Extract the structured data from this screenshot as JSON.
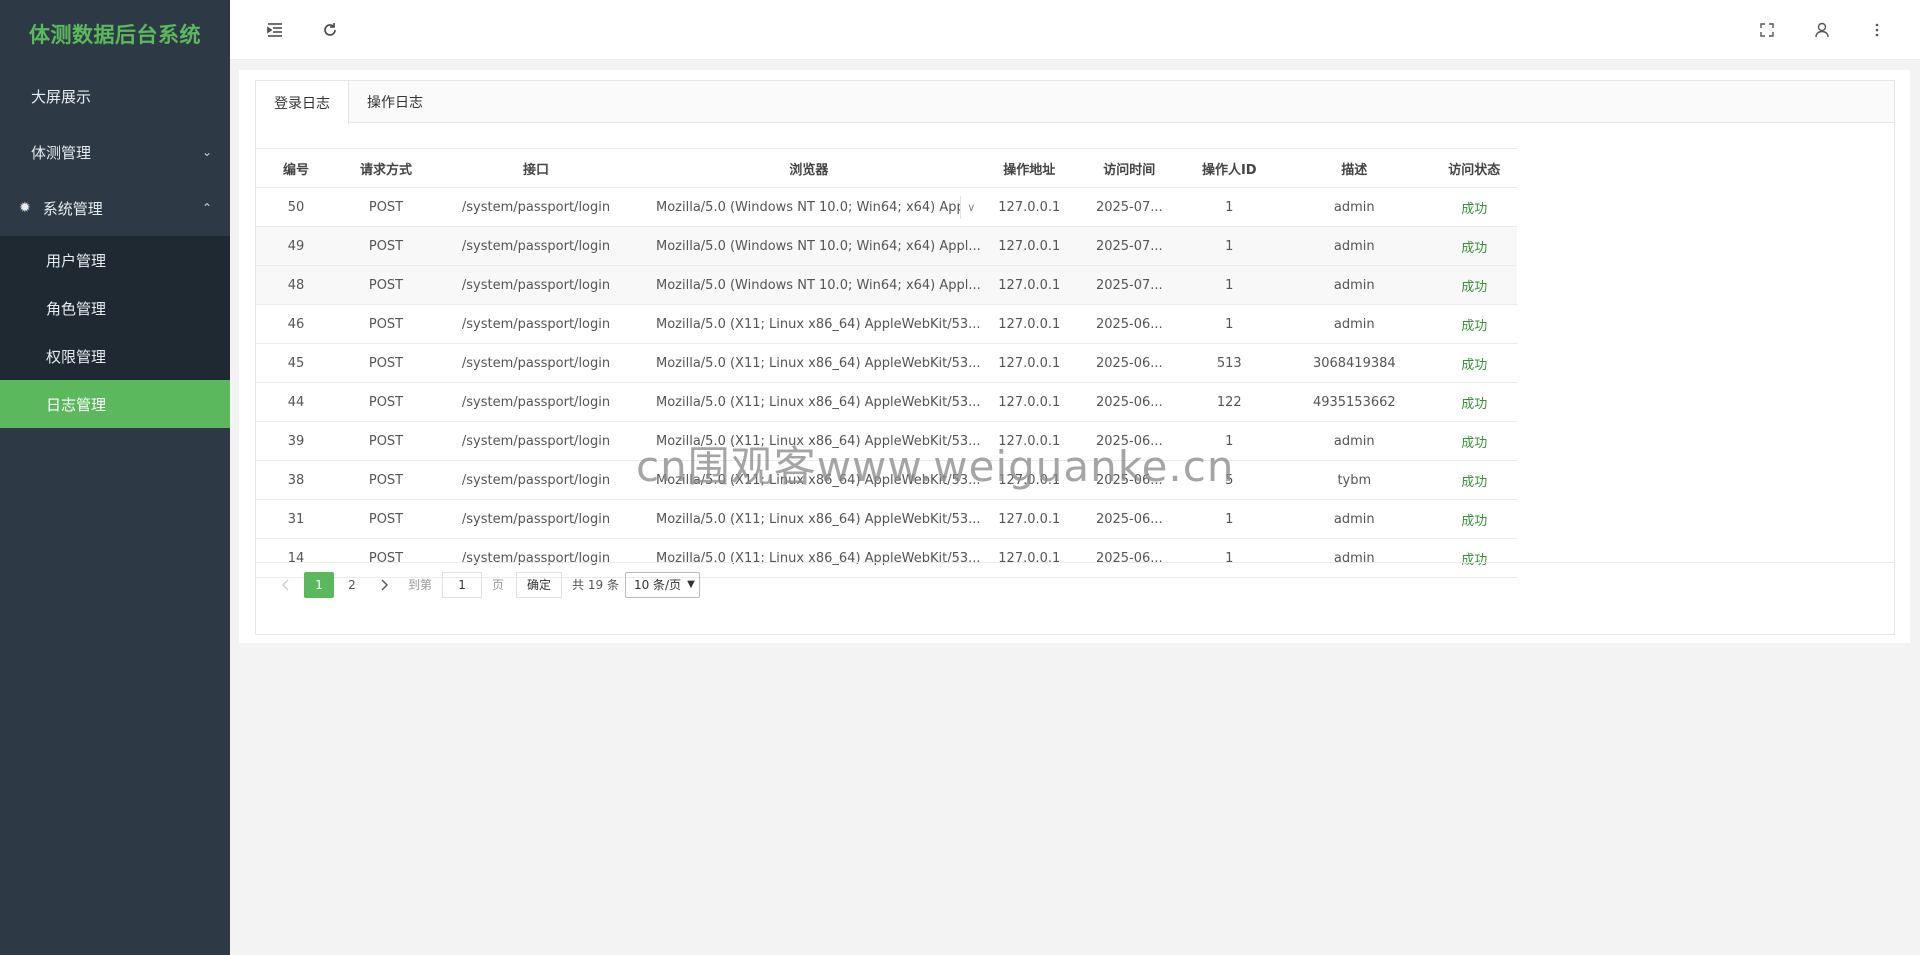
{
  "app": {
    "title": "体测数据后台系统"
  },
  "sidebar": {
    "items": [
      {
        "label": "大屏展示"
      },
      {
        "label": "体测管理"
      },
      {
        "label": "系统管理"
      }
    ],
    "submenu": [
      {
        "label": "用户管理"
      },
      {
        "label": "角色管理"
      },
      {
        "label": "权限管理"
      },
      {
        "label": "日志管理"
      }
    ]
  },
  "header": {
    "icons": [
      "menu-toggle-icon",
      "refresh-icon",
      "fullscreen-icon",
      "user-icon",
      "more-icon"
    ]
  },
  "tabs": [
    {
      "label": "登录日志"
    },
    {
      "label": "操作日志"
    }
  ],
  "table": {
    "columns": [
      "编号",
      "请求方式",
      "接口",
      "浏览器",
      "操作地址",
      "访问时间",
      "操作人ID",
      "描述",
      "访问状态"
    ],
    "rows": [
      [
        "50",
        "POST",
        "/system/passport/login",
        "Mozilla/5.0 (Windows NT 10.0; Win64; x64) Appl...",
        "127.0.0.1",
        "2025-07...",
        "1",
        "admin",
        "成功"
      ],
      [
        "49",
        "POST",
        "/system/passport/login",
        "Mozilla/5.0 (Windows NT 10.0; Win64; x64) Appl...",
        "127.0.0.1",
        "2025-07...",
        "1",
        "admin",
        "成功"
      ],
      [
        "48",
        "POST",
        "/system/passport/login",
        "Mozilla/5.0 (Windows NT 10.0; Win64; x64) Appl...",
        "127.0.0.1",
        "2025-07...",
        "1",
        "admin",
        "成功"
      ],
      [
        "46",
        "POST",
        "/system/passport/login",
        "Mozilla/5.0 (X11; Linux x86_64) AppleWebKit/53...",
        "127.0.0.1",
        "2025-06...",
        "1",
        "admin",
        "成功"
      ],
      [
        "45",
        "POST",
        "/system/passport/login",
        "Mozilla/5.0 (X11; Linux x86_64) AppleWebKit/53...",
        "127.0.0.1",
        "2025-06...",
        "513",
        "3068419384",
        "成功"
      ],
      [
        "44",
        "POST",
        "/system/passport/login",
        "Mozilla/5.0 (X11; Linux x86_64) AppleWebKit/53...",
        "127.0.0.1",
        "2025-06...",
        "122",
        "4935153662",
        "成功"
      ],
      [
        "39",
        "POST",
        "/system/passport/login",
        "Mozilla/5.0 (X11; Linux x86_64) AppleWebKit/53...",
        "127.0.0.1",
        "2025-06...",
        "1",
        "admin",
        "成功"
      ],
      [
        "38",
        "POST",
        "/system/passport/login",
        "Mozilla/5.0 (X11; Linux x86_64) AppleWebKit/53...",
        "127.0.0.1",
        "2025-06...",
        "5",
        "tybm",
        "成功"
      ],
      [
        "31",
        "POST",
        "/system/passport/login",
        "Mozilla/5.0 (X11; Linux x86_64) AppleWebKit/53...",
        "127.0.0.1",
        "2025-06...",
        "1",
        "admin",
        "成功"
      ],
      [
        "14",
        "POST",
        "/system/passport/login",
        "Mozilla/5.0 (X11; Linux x86_64) AppleWebKit/53...",
        "127.0.0.1",
        "2025-06...",
        "1",
        "admin",
        "成功"
      ]
    ]
  },
  "pagination": {
    "pages": [
      "1",
      "2"
    ],
    "current": "1",
    "goto_label": "到第",
    "goto_value": "1",
    "page_unit": "页",
    "confirm_label": "确定",
    "total_label": "共 19 条",
    "page_size": "10 条/页"
  },
  "watermark": "cn围观客www.weiguanke.cn",
  "colors": {
    "accent": "#5cb85c",
    "sidebar_bg": "#2d3a45",
    "submenu_bg": "#1f2931",
    "success_text": "#3a8f3a"
  }
}
